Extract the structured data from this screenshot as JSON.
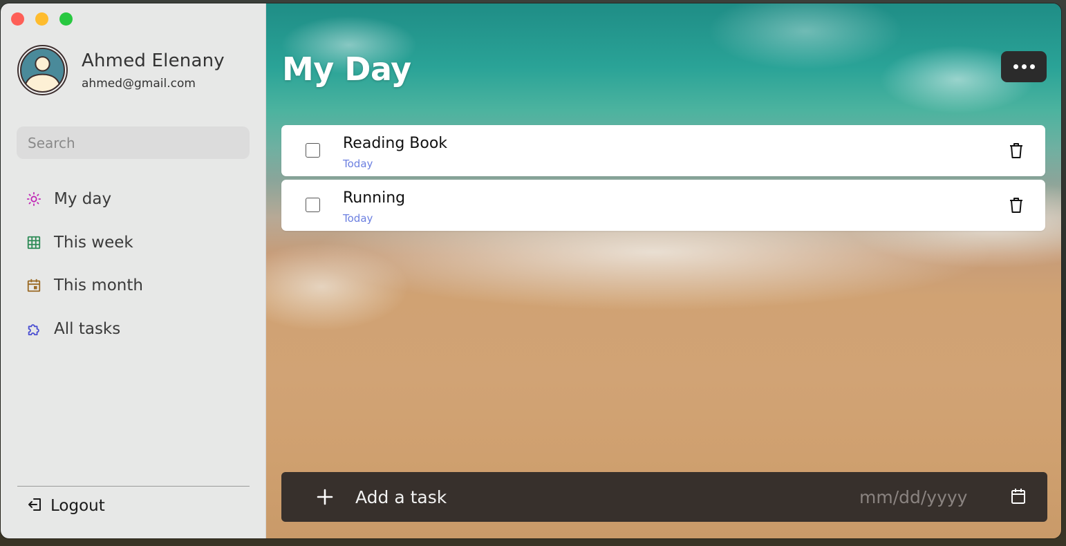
{
  "user": {
    "name": "Ahmed Elenany",
    "email": "ahmed@gmail.com"
  },
  "search": {
    "placeholder": "Search",
    "value": ""
  },
  "nav": {
    "items": [
      {
        "label": "My day",
        "icon": "sun-icon",
        "color": "#c026b5"
      },
      {
        "label": "This week",
        "icon": "table-grid-icon",
        "color": "#2e8b57"
      },
      {
        "label": "This month",
        "icon": "calendar-icon",
        "color": "#9a6a25"
      },
      {
        "label": "All tasks",
        "icon": "puzzle-icon",
        "color": "#4b4fd1"
      }
    ],
    "logout_label": "Logout"
  },
  "main": {
    "title": "My Day",
    "more_icon": "more-horizontal-icon"
  },
  "tasks": [
    {
      "title": "Reading Book",
      "date": "Today",
      "checked": false
    },
    {
      "title": "Running",
      "date": "Today",
      "checked": false
    }
  ],
  "add_task": {
    "placeholder": "Add a task",
    "date_placeholder": "mm/dd/yyyy"
  },
  "colors": {
    "sidebar_bg": "#e7e8e7",
    "accent_date": "#6b7fe0",
    "add_bar_bg": "#37302c",
    "more_button_bg": "#2b2b2b"
  }
}
